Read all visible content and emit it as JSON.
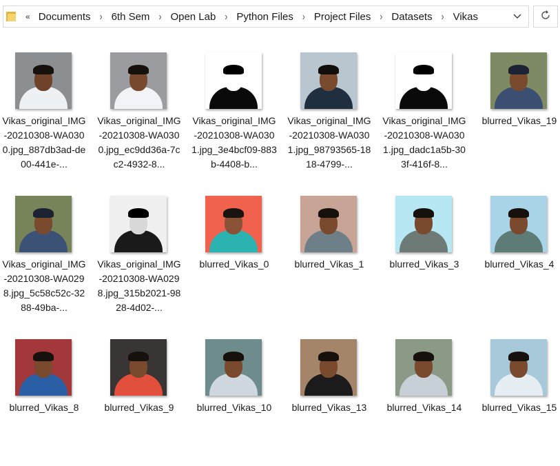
{
  "address_bar": {
    "overflow_label": "«",
    "breadcrumbs": [
      "Documents",
      "6th Sem",
      "Open Lab",
      "Python Files",
      "Project Files",
      "Datasets",
      "Vikas"
    ],
    "dropdown_icon": "chevron-down-icon",
    "refresh_icon": "refresh-icon"
  },
  "items": [
    {
      "label": "Vikas_original_IMG-20210308-WA0300.jpg_887db3ad-de00-441e-...",
      "bg": "#8c8f92",
      "shirt": "#eef1f4",
      "face": "#6e432a",
      "hair": "#16110c"
    },
    {
      "label": "Vikas_original_IMG-20210308-WA0300.jpg_ec9dd36a-7cc2-4932-8...",
      "bg": "#9a9ca0",
      "shirt": "#f1f3f6",
      "face": "#77492e",
      "hair": "#16110c"
    },
    {
      "label": "Vikas_original_IMG-20210308-WA0301.jpg_3e4bcf09-883b-4408-b...",
      "bg": "#ffffff",
      "shirt": "#0a0a0a",
      "face": "#ffffff",
      "hair": "#000000"
    },
    {
      "label": "Vikas_original_IMG-20210308-WA0301.jpg_98793565-1818-4799-...",
      "bg": "#b9c6cf",
      "shirt": "#1f2f3f",
      "face": "#7a4a2e",
      "hair": "#120e0b"
    },
    {
      "label": "Vikas_original_IMG-20210308-WA0301.jpg_dadc1a5b-303f-416f-8...",
      "bg": "#ffffff",
      "shirt": "#0a0a0a",
      "face": "#ffffff",
      "hair": "#000000"
    },
    {
      "label": "blurred_Vikas_19",
      "bg": "#7d8a63",
      "shirt": "#3a4f72",
      "face": "#7a4a2e",
      "hair": "#1b2232"
    },
    {
      "label": "Vikas_original_IMG-20210308-WA0298.jpg_5c58c52c-3288-49ba-...",
      "bg": "#77845a",
      "shirt": "#3b5276",
      "face": "#7a4a2e",
      "hair": "#1b2232"
    },
    {
      "label": "Vikas_original_IMG-20210308-WA0298.jpg_315b2021-9828-4d02-...",
      "bg": "#f0f0f0",
      "shirt": "#1a1a1a",
      "face": "#d8d8d8",
      "hair": "#000000"
    },
    {
      "label": "blurred_Vikas_0",
      "bg": "#f0624e",
      "shirt": "#2bb3b1",
      "face": "#8a5236",
      "hair": "#1a1410"
    },
    {
      "label": "blurred_Vikas_1",
      "bg": "#c7a496",
      "shirt": "#6e7f88",
      "face": "#7a4a2e",
      "hair": "#16110c"
    },
    {
      "label": "blurred_Vikas_3",
      "bg": "#b7e7f3",
      "shirt": "#6d7a76",
      "face": "#7a4a2e",
      "hair": "#16110c"
    },
    {
      "label": "blurred_Vikas_4",
      "bg": "#a9d3e6",
      "shirt": "#5d7c78",
      "face": "#7a4a2e",
      "hair": "#16110c"
    },
    {
      "label": "blurred_Vikas_8",
      "bg": "#a3383b",
      "shirt": "#2a5fa5",
      "face": "#7a4a2e",
      "hair": "#16110c"
    },
    {
      "label": "blurred_Vikas_9",
      "bg": "#3a3535",
      "shirt": "#e34f3d",
      "face": "#7a4a2e",
      "hair": "#16110c"
    },
    {
      "label": "blurred_Vikas_10",
      "bg": "#6f8c8c",
      "shirt": "#cfd8df",
      "face": "#7a4a2e",
      "hair": "#16110c"
    },
    {
      "label": "blurred_Vikas_13",
      "bg": "#a5856a",
      "shirt": "#1b1b1b",
      "face": "#7a4a2e",
      "hair": "#16110c"
    },
    {
      "label": "blurred_Vikas_14",
      "bg": "#8a9a86",
      "shirt": "#c7d0d6",
      "face": "#7a4a2e",
      "hair": "#16110c"
    },
    {
      "label": "blurred_Vikas_15",
      "bg": "#a7c9d9",
      "shirt": "#e6edf3",
      "face": "#7a4a2e",
      "hair": "#16110c"
    }
  ]
}
